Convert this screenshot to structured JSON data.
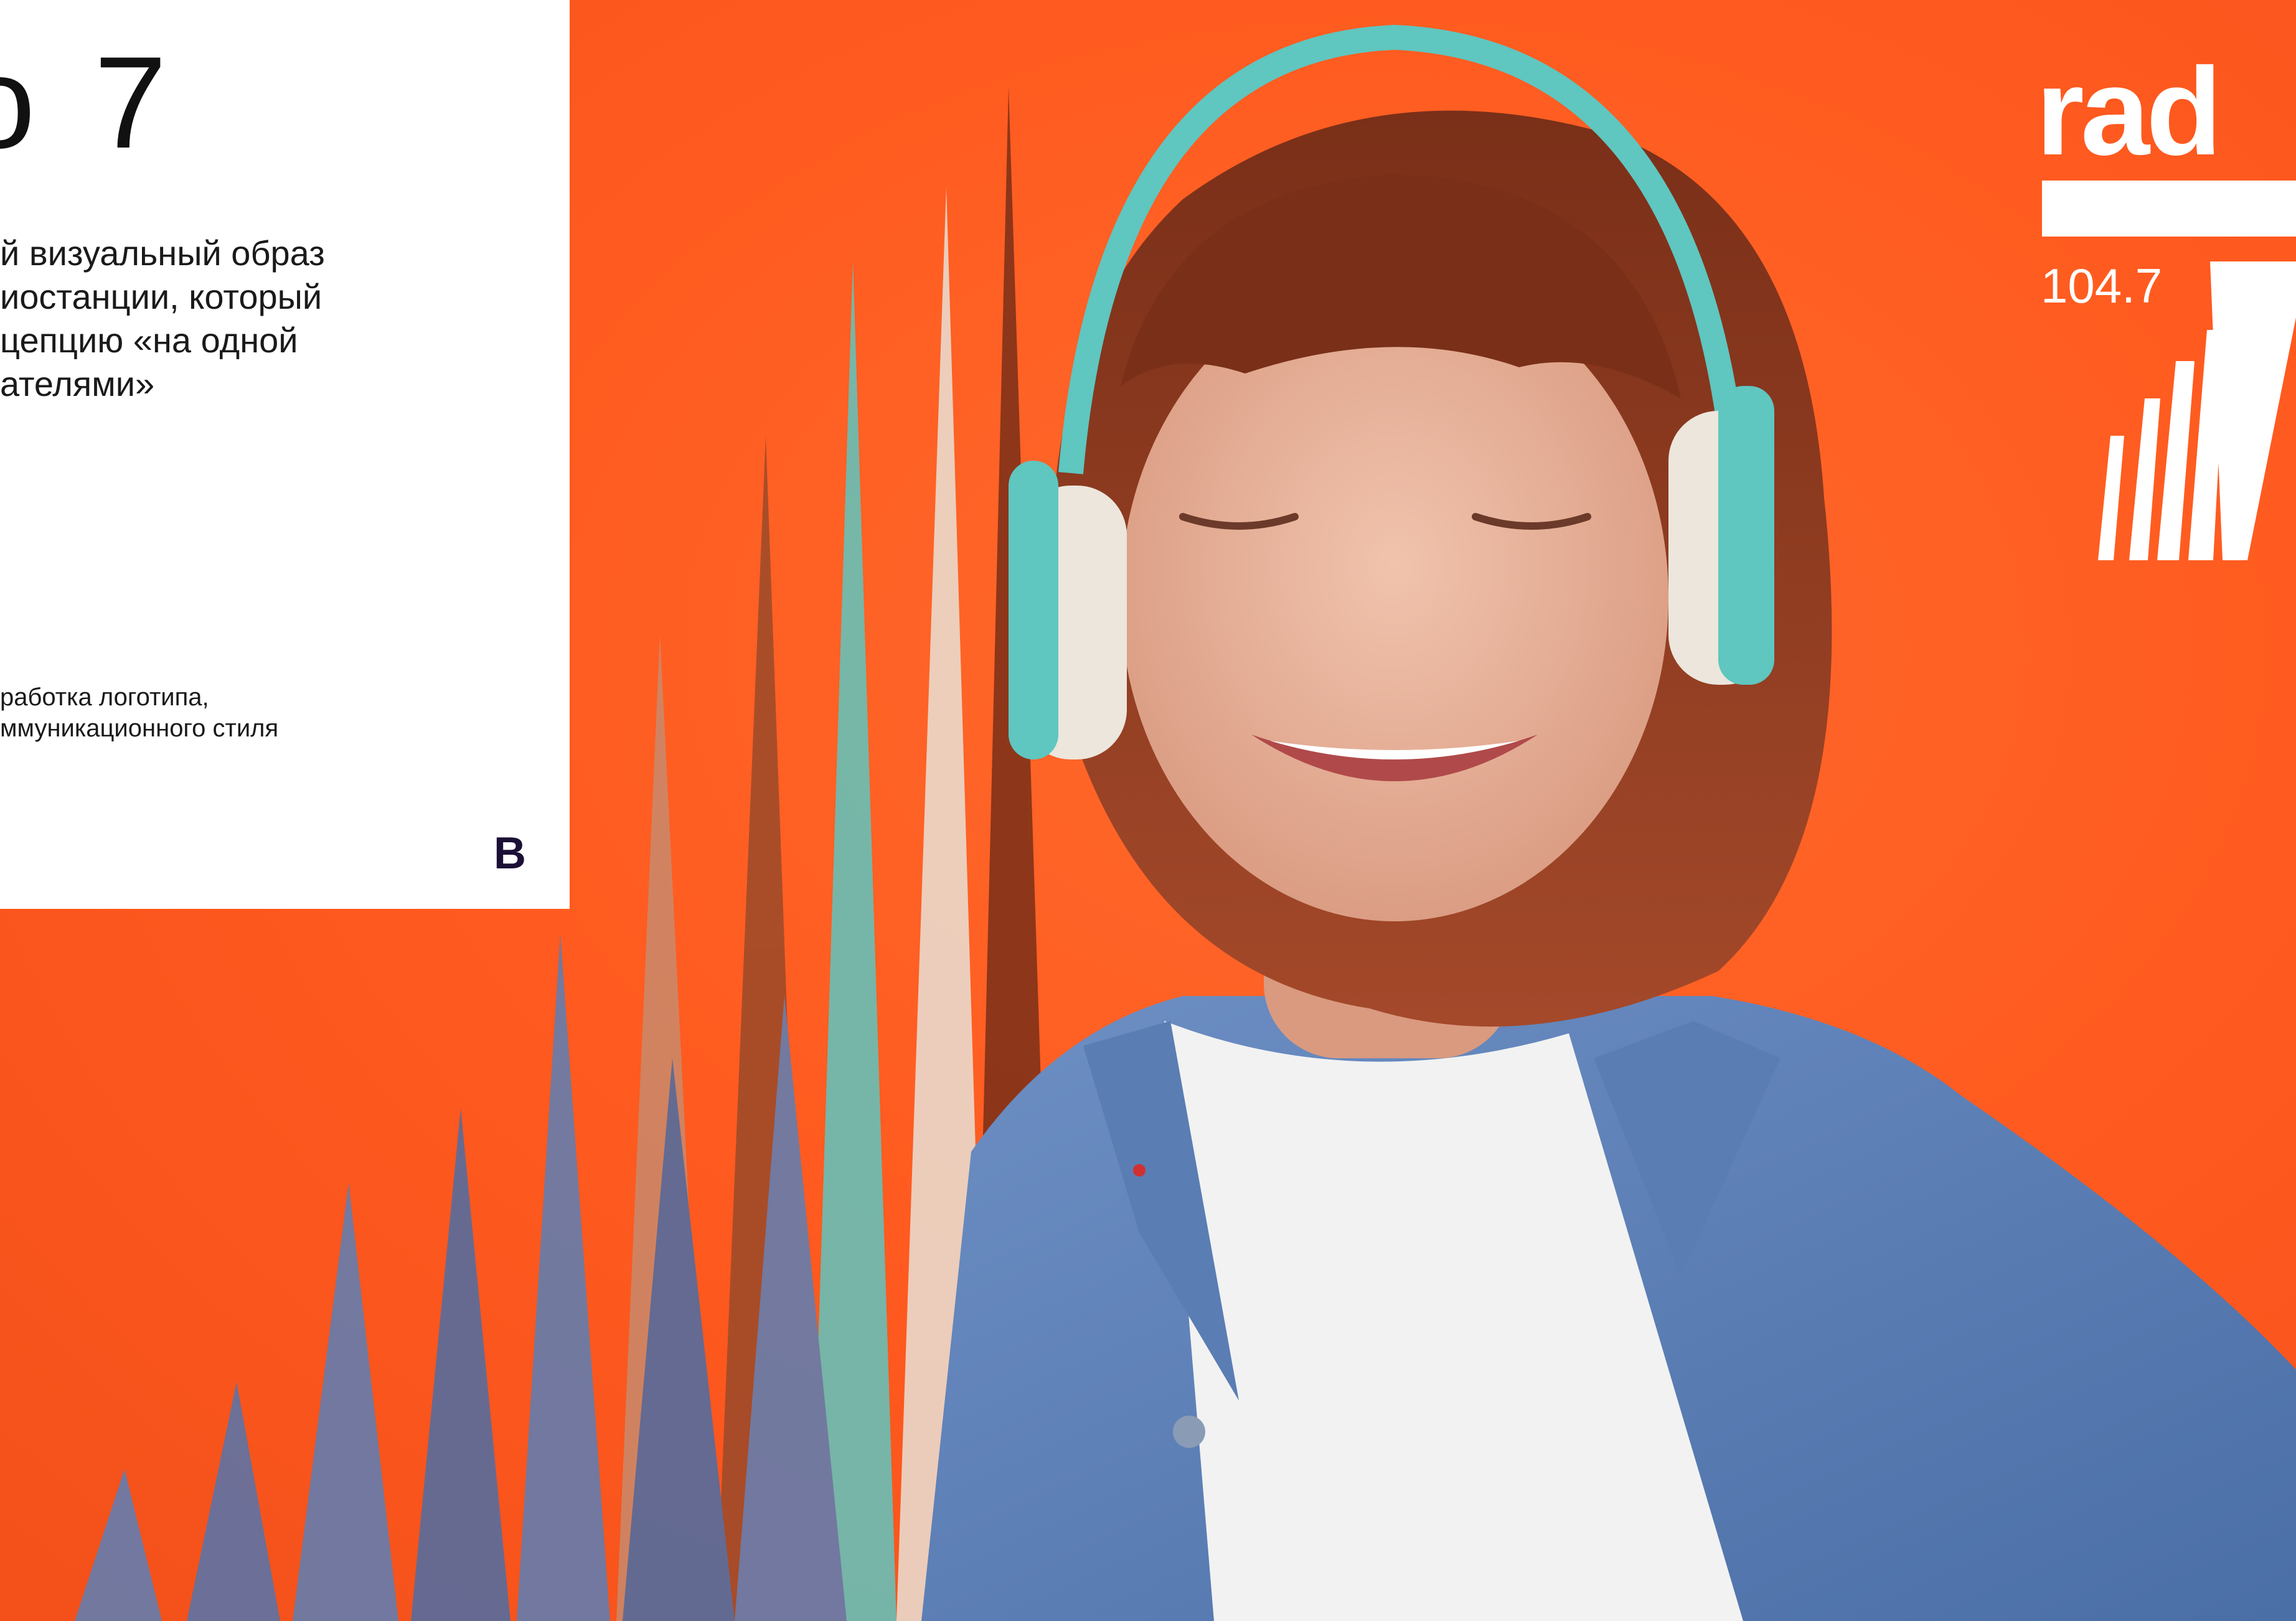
{
  "card": {
    "title": "о 7",
    "description_lines": [
      "й визуальный образ",
      "иостанции, который",
      "цепцию «на одной",
      "ателями»"
    ],
    "services_lines": [
      "работка логотипа,",
      "ммуникационного стиля"
    ],
    "studio_mark": "B"
  },
  "logo": {
    "wordmark": "rad",
    "frequency": "104.7"
  },
  "colors": {
    "background": "#ff5a1f",
    "card": "#ffffff",
    "mark": "#1b1035",
    "headphones": "#5fc6c0",
    "shirt": "#5b7fb6",
    "hair": "#8a3a1e"
  }
}
